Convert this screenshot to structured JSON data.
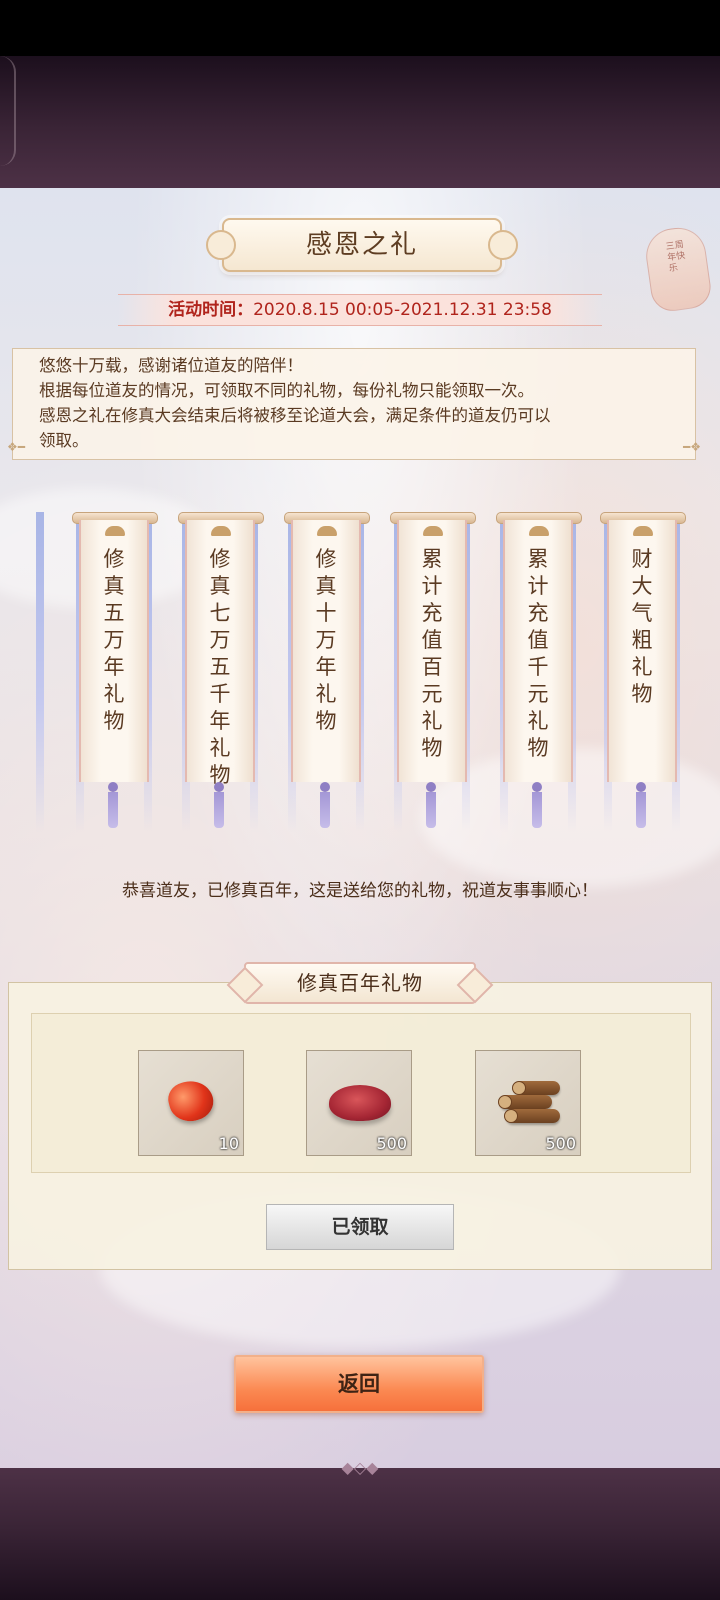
{
  "header": {
    "title": "感恩之礼",
    "time_label": "活动时间：",
    "time_range": "2020.8.15 00:05-2021.12.31 23:58"
  },
  "description": {
    "lines": [
      "悠悠十万载，感谢诸位道友的陪伴！",
      "根据每位道友的情况，可领取不同的礼物，每份礼物只能领取一次。",
      "感恩之礼在修真大会结束后将被移至论道大会，满足条件的道友仍可以",
      "领取。"
    ]
  },
  "background_lantern_text": "三周年快乐",
  "scrolls": [
    {
      "chars": [
        "修",
        "真",
        "五",
        "万",
        "年",
        "礼",
        "物"
      ]
    },
    {
      "chars": [
        "修",
        "真",
        "七",
        "万",
        "五",
        "千",
        "年",
        "礼",
        "物"
      ]
    },
    {
      "chars": [
        "修",
        "真",
        "十",
        "万",
        "年",
        "礼",
        "物"
      ]
    },
    {
      "chars": [
        "累",
        "计",
        "充",
        "值",
        "百",
        "元",
        "礼",
        "物"
      ]
    },
    {
      "chars": [
        "累",
        "计",
        "充",
        "值",
        "千",
        "元",
        "礼",
        "物"
      ]
    },
    {
      "chars": [
        "财",
        "大",
        "气",
        "粗",
        "礼",
        "物"
      ]
    }
  ],
  "congrats_text": "恭喜道友，已修真百年，这是送给您的礼物，祝道友事事顺心！",
  "gift": {
    "title": "修真百年礼物",
    "items": [
      {
        "icon": "red-gem-icon",
        "count": "10"
      },
      {
        "icon": "meat-icon",
        "count": "500"
      },
      {
        "icon": "wood-logs-icon",
        "count": "500"
      }
    ],
    "claim_label": "已领取"
  },
  "return_label": "返回",
  "colors": {
    "time_text": "#b0241c",
    "return_button": "#fb8a53",
    "frame": "#3a2436"
  }
}
